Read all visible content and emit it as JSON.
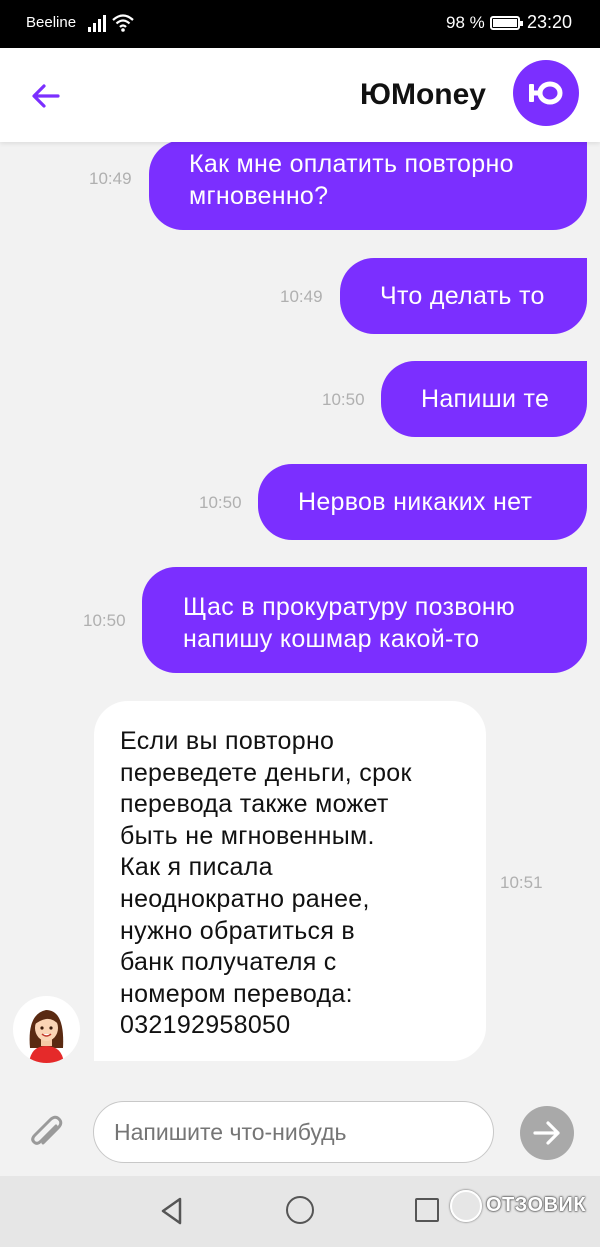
{
  "status_bar": {
    "carrier": "Beeline",
    "battery": "98 %",
    "time": "23:20"
  },
  "header": {
    "title": "ЮMoney",
    "logo_text": "ЮО",
    "accent": "#7b2fff"
  },
  "messages": [
    {
      "direction": "out",
      "time": "10:49",
      "lines": [
        "Как мне оплатить повторно",
        "мгновенно?"
      ]
    },
    {
      "direction": "out",
      "time": "10:49",
      "lines": [
        "Что делать то"
      ]
    },
    {
      "direction": "out",
      "time": "10:50",
      "lines": [
        "Напиши те"
      ]
    },
    {
      "direction": "out",
      "time": "10:50",
      "lines": [
        "Нервов никаких нет"
      ]
    },
    {
      "direction": "out",
      "time": "10:50",
      "lines": [
        "Щас в прокуратуру позвоню",
        "напишу кошмар какой-то"
      ]
    },
    {
      "direction": "in",
      "time": "10:51",
      "lines": [
        "Если вы повторно",
        "переведете деньги, срок",
        "перевода также может",
        "быть не мгновенным.",
        "Как я писала",
        "неоднократно ранее,",
        "нужно обратиться в",
        "банк получателя с",
        "номером перевода:",
        "032192958050"
      ]
    }
  ],
  "composer": {
    "placeholder": "Напишите что-нибудь"
  },
  "watermark": "ОТЗОВИК"
}
